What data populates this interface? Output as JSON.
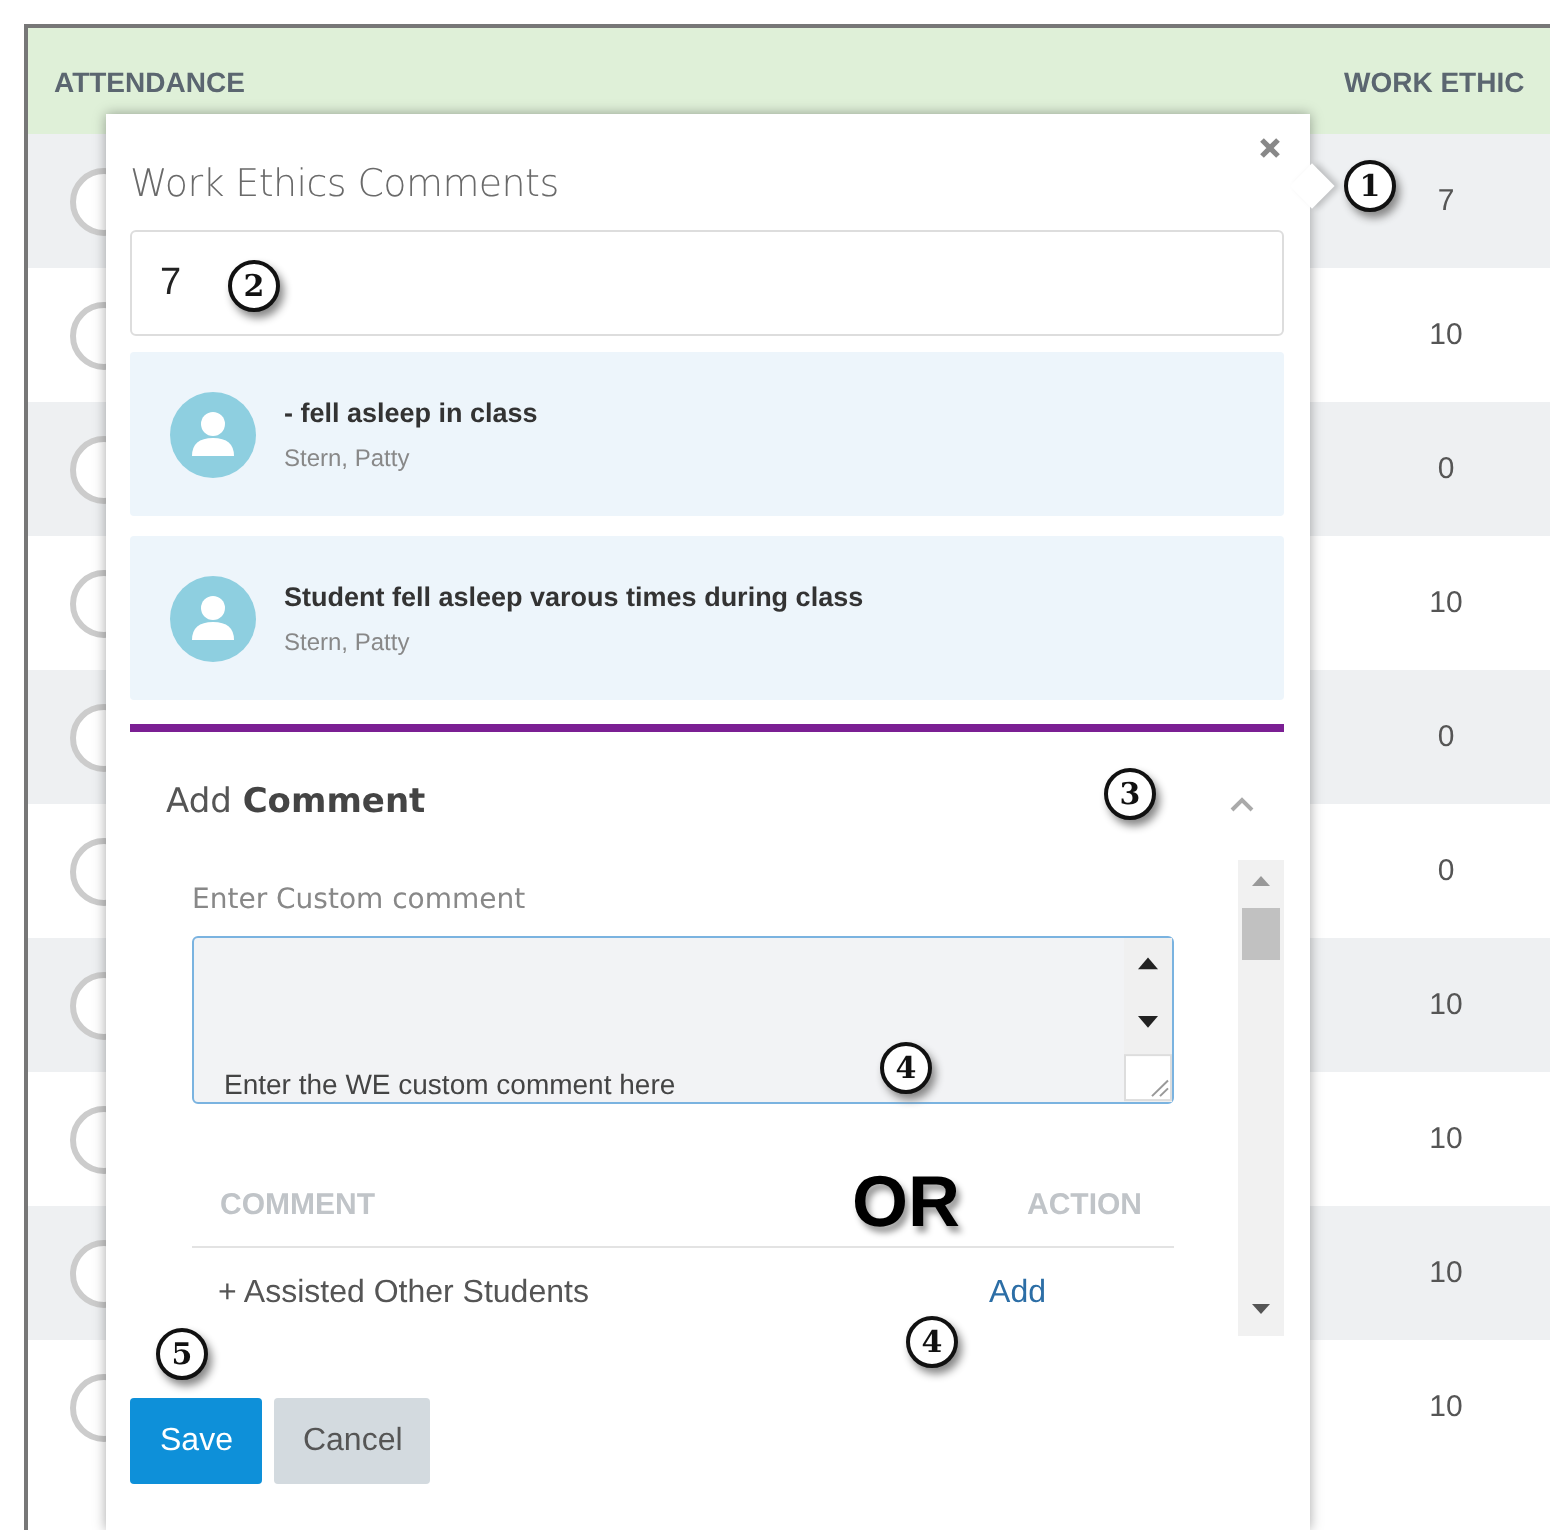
{
  "table": {
    "columns": [
      "ATTENDANCE",
      "WORK ETHIC"
    ],
    "rows": [
      {
        "work_ethic": "7"
      },
      {
        "work_ethic": "10"
      },
      {
        "work_ethic": "0"
      },
      {
        "work_ethic": "10"
      },
      {
        "work_ethic": "0"
      },
      {
        "work_ethic": "0"
      },
      {
        "work_ethic": "10"
      },
      {
        "work_ethic": "10"
      },
      {
        "work_ethic": "10"
      },
      {
        "work_ethic": "10"
      }
    ]
  },
  "popup": {
    "title": "Work Ethics Comments",
    "score_field": {
      "value": "7"
    },
    "comments": [
      {
        "text": "- fell asleep in class",
        "author": "Stern, Patty"
      },
      {
        "text": "Student fell asleep varous times during class",
        "author": "Stern, Patty"
      }
    ],
    "add_comment": {
      "title": "Add **Comment**",
      "expanded": true,
      "custom_label": "Enter Custom comment",
      "custom_value": "Enter the WE custom comment here",
      "columns": [
        "COMMENT",
        "ACTION"
      ],
      "rows": [
        {
          "comment": "+ Assisted Other Students",
          "action": "Add"
        }
      ]
    },
    "buttons": [
      {
        "label": "Save",
        "kind": "primary"
      },
      {
        "label": "Cancel",
        "kind": "secondary"
      }
    ]
  },
  "annotations": [
    "1",
    "2",
    "3",
    "4",
    "4",
    "5"
  ],
  "or_label": "OR"
}
